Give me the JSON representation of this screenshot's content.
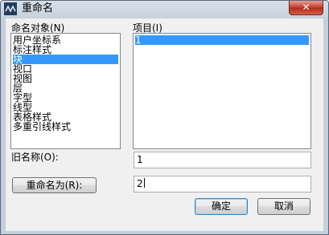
{
  "window": {
    "title": "重命名",
    "close_label": "✕",
    "accent": "#3399ff"
  },
  "labels": {
    "named_objects": "命名对象(N)",
    "items": "项目(I)",
    "old_name": "旧名称(O):"
  },
  "named_objects": [
    {
      "label": "用户坐标系",
      "selected": false
    },
    {
      "label": "标注样式",
      "selected": false
    },
    {
      "label": "块",
      "selected": true
    },
    {
      "label": "视口",
      "selected": false
    },
    {
      "label": "视图",
      "selected": false
    },
    {
      "label": "层",
      "selected": false
    },
    {
      "label": "字型",
      "selected": false
    },
    {
      "label": "线型",
      "selected": false
    },
    {
      "label": "表格样式",
      "selected": false
    },
    {
      "label": "多重引线样式",
      "selected": false
    }
  ],
  "items": [
    {
      "label": "1",
      "selected": true
    }
  ],
  "old_name_value": "1",
  "new_name_value": "2",
  "buttons": {
    "rename_to": "重命名为(R):",
    "ok": "确定",
    "cancel": "取消"
  }
}
